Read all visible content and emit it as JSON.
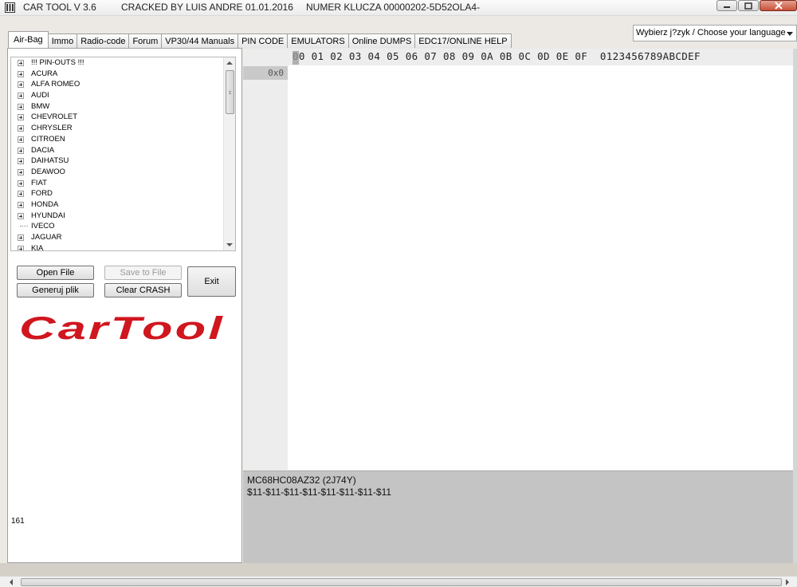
{
  "window": {
    "title_app": "CAR TOOL V 3.6",
    "title_crack": "CRACKED BY LUIS ANDRE 01.01.2016",
    "title_key": "NUMER KLUCZA 00000202-5D52OLA4-"
  },
  "tabs": [
    {
      "label": "Air-Bag",
      "active": true
    },
    {
      "label": "Immo"
    },
    {
      "label": "Radio-code"
    },
    {
      "label": "Forum"
    },
    {
      "label": "VP30/44 Manuals"
    },
    {
      "label": "PIN CODE"
    },
    {
      "label": "EMULATORS"
    },
    {
      "label": "Online DUMPS"
    },
    {
      "label": "EDC17/ONLINE HELP"
    }
  ],
  "language_select": {
    "value": "Wybierz j?zyk / Choose your language"
  },
  "tree": {
    "items": [
      {
        "label": "!!! PIN-OUTS !!!",
        "expandable": true
      },
      {
        "label": "ACURA",
        "expandable": true
      },
      {
        "label": "ALFA ROMEO",
        "expandable": true
      },
      {
        "label": "AUDI",
        "expandable": true
      },
      {
        "label": "BMW",
        "expandable": true
      },
      {
        "label": "CHEVROLET",
        "expandable": true
      },
      {
        "label": "CHRYSLER",
        "expandable": true
      },
      {
        "label": "CITROEN",
        "expandable": true
      },
      {
        "label": "DACIA",
        "expandable": true
      },
      {
        "label": "DAIHATSU",
        "expandable": true
      },
      {
        "label": "DEAWOO",
        "expandable": true
      },
      {
        "label": "FIAT",
        "expandable": true
      },
      {
        "label": "FORD",
        "expandable": true
      },
      {
        "label": "HONDA",
        "expandable": true
      },
      {
        "label": "HYUNDAI",
        "expandable": true
      },
      {
        "label": "IVECO",
        "expandable": false
      },
      {
        "label": "JAGUAR",
        "expandable": true
      },
      {
        "label": "KIA",
        "expandable": true
      }
    ]
  },
  "buttons": {
    "open_file": "Open File",
    "save_to_file": "Save to File",
    "generate_file": "Generuj plik",
    "clear_crash": "Clear CRASH",
    "exit": "Exit"
  },
  "logo": {
    "text": "CarTool",
    "color": "#d0161e"
  },
  "counter": "161",
  "hex": {
    "header": "00 01 02 03 04 05 06 07 08 09 0A 0B 0C 0D 0E 0F  0123456789ABCDEF",
    "first_row_address": "0x0"
  },
  "info": {
    "chip": "MC68HC08AZ32 (2J74Y)",
    "data": "$11-$11-$11-$11-$11-$11-$11-$11"
  }
}
